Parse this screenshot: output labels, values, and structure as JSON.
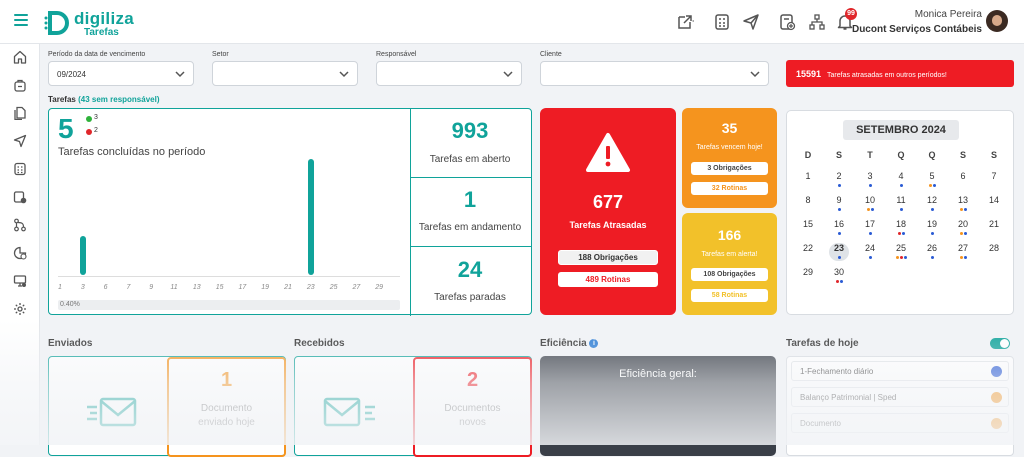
{
  "brand": {
    "name": "digiliza",
    "subtitle": "Tarefas",
    "color": "#10a39a"
  },
  "header": {
    "user_name": "Monica Pereira",
    "company": "Ducont Serviços Contábeis",
    "notification_count": "99",
    "icons": [
      "external-link-icon",
      "calculator-icon",
      "send-icon",
      "add-document-icon",
      "network-icon",
      "bell-icon"
    ]
  },
  "sidebar": {
    "icons": [
      "home-icon",
      "bag-icon",
      "documents-icon",
      "send-icon",
      "calculator-icon",
      "doc-alert-icon",
      "flow-icon",
      "chart-clock-icon",
      "monitor-icon",
      "settings-icon"
    ]
  },
  "filters": {
    "period_label": "Período da data de vencimento",
    "period_value": "09/2024",
    "sector_label": "Setor",
    "sector_value": "",
    "responsible_label": "Responsável",
    "responsible_value": "",
    "client_label": "Cliente",
    "client_value": ""
  },
  "late_alert": {
    "count": "15591",
    "text": "Tarefas atrasadas em outros períodos!"
  },
  "tasks": {
    "title": "Tarefas",
    "unassigned": "(43 sem responsável)",
    "completed_count": "5",
    "green_count": "3",
    "red_count": "2",
    "completed_label": "Tarefas concluídas no período",
    "percent": "0.40%",
    "open_count": "993",
    "open_label": "Tarefas em aberto",
    "progress_count": "1",
    "progress_label": "Tarefas em andamento",
    "stopped_count": "24",
    "stopped_label": "Tarefas paradas"
  },
  "chart_data": {
    "type": "bar",
    "categories": [
      "1",
      "3",
      "6",
      "7",
      "9",
      "11",
      "13",
      "15",
      "17",
      "19",
      "21",
      "23",
      "25",
      "27",
      "29"
    ],
    "values": [
      0,
      1,
      0,
      0,
      0,
      0,
      0,
      0,
      0,
      0,
      0,
      3,
      0,
      0,
      0
    ],
    "ylim": [
      0,
      3
    ],
    "color": "#10a39a"
  },
  "overdue": {
    "count": "677",
    "label": "Tarefas Atrasadas",
    "obligations": "188 Obrigações",
    "routines": "489 Rotinas",
    "color": "#ee1c24"
  },
  "due_today": {
    "count": "35",
    "label": "Tarefas vencem hoje!",
    "obligations": "3 Obrigações",
    "routines": "32 Rotinas",
    "color": "#f5941e"
  },
  "alert_tasks": {
    "count": "166",
    "label": "Tarefas em alerta!",
    "obligations": "108 Obrigações",
    "routines": "58 Rotinas",
    "color": "#f2c12a"
  },
  "calendar": {
    "title": "SETEMBRO 2024",
    "weekdays": [
      "D",
      "S",
      "T",
      "Q",
      "Q",
      "S",
      "S"
    ],
    "weeks": [
      [
        "1",
        "2",
        "3",
        "4",
        "5",
        "6",
        "7"
      ],
      [
        "8",
        "9",
        "10",
        "11",
        "12",
        "13",
        "14"
      ],
      [
        "15",
        "16",
        "17",
        "18",
        "19",
        "20",
        "21"
      ],
      [
        "22",
        "23",
        "24",
        "25",
        "26",
        "27",
        "28"
      ],
      [
        "29",
        "30",
        "",
        "",
        "",
        "",
        ""
      ]
    ],
    "today": "23"
  },
  "bottom": {
    "sent_title": "Enviados",
    "sent_count": "1",
    "sent_label_1": "Documento",
    "sent_label_2": "enviado hoje",
    "received_title": "Recebidos",
    "received_count": "2",
    "received_label_1": "Documentos",
    "received_label_2": "novos",
    "efficiency_title": "Eficiência",
    "efficiency_label": "Eficiência geral:",
    "today_title": "Tarefas de hoje",
    "today_items": [
      "1-Fechamento diário",
      "Balanço Patrimonial | Sped",
      "Documento"
    ]
  }
}
